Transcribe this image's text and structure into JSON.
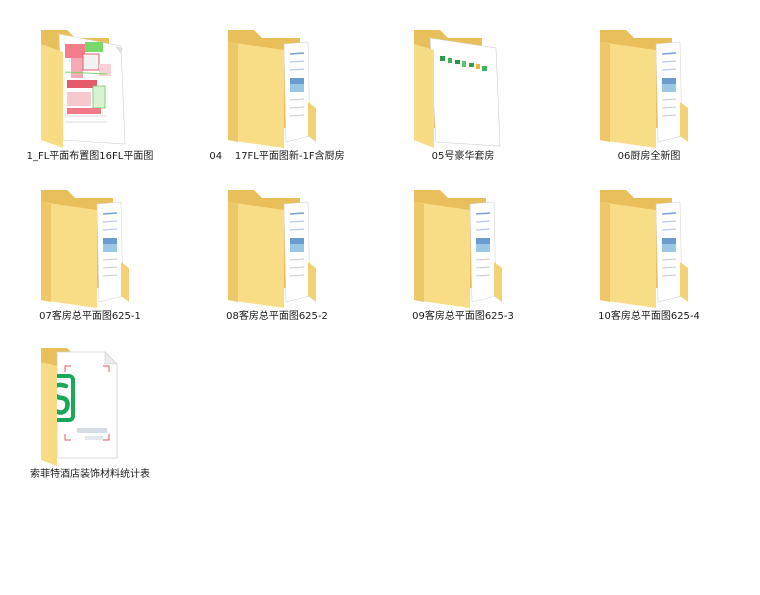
{
  "items": [
    {
      "label": "1_FL平面布置图16FL平面图",
      "kind": "folder-blueprint",
      "icon": "folder-icon"
    },
    {
      "label": "04    17FL平面图新-1F含厨房",
      "kind": "folder-docs",
      "icon": "folder-icon"
    },
    {
      "label": "05号豪华套房",
      "kind": "folder-sheet",
      "icon": "folder-icon"
    },
    {
      "label": "06厨房全新图",
      "kind": "folder-docs",
      "icon": "folder-icon"
    },
    {
      "label": "07客房总平面图625-1",
      "kind": "folder-docs",
      "icon": "folder-icon"
    },
    {
      "label": "08客房总平面图625-2",
      "kind": "folder-docs",
      "icon": "folder-icon"
    },
    {
      "label": "09客房总平面图625-3",
      "kind": "folder-docs",
      "icon": "folder-icon"
    },
    {
      "label": "10客房总平面图625-4",
      "kind": "folder-docs",
      "icon": "folder-icon"
    },
    {
      "label": "索菲特酒店装饰材料统计表",
      "kind": "spreadsheet-file",
      "icon": "spreadsheet-file-icon"
    }
  ],
  "colors": {
    "folder_back": "#f4d27a",
    "folder_front": "#fde59a",
    "spreadsheet_green": "#19a85a"
  }
}
